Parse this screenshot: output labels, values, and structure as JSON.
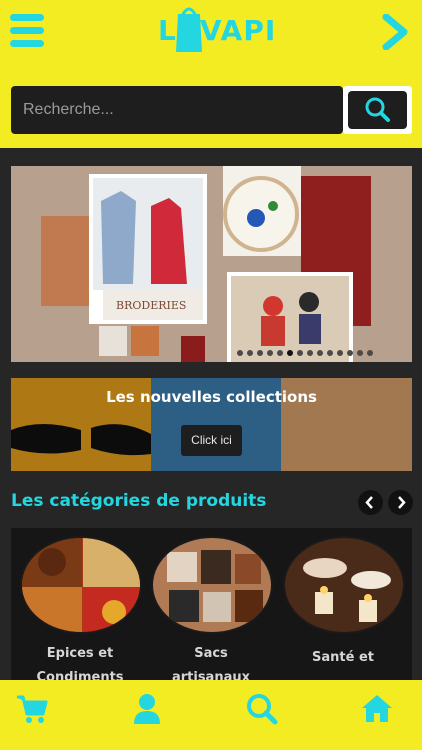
{
  "header": {
    "logo_text": "LOVAPI",
    "menu_icon": "hamburger-menu-icon",
    "next_icon": "chevron-right-icon",
    "accent_color": "#24d6e0",
    "background_color": "#f3ec23"
  },
  "search": {
    "placeholder": "Recherche...",
    "button_icon": "search-icon"
  },
  "banner": {
    "caption": "BRODERIES",
    "slide_count": 14,
    "active_slide": 6
  },
  "collection": {
    "title": "Les nouvelles collections",
    "button_label": "Click ici"
  },
  "categories": {
    "title": "Les catégories de produits",
    "prev_icon": "chevron-left-icon",
    "next_icon": "chevron-right-icon",
    "items": [
      {
        "label": "Epices et",
        "label2": "Condiments"
      },
      {
        "label": "Sacs",
        "label2": "artisanaux"
      },
      {
        "label": "Santé et",
        "label2": ""
      }
    ]
  },
  "bottom_nav": [
    {
      "icon": "cart-icon"
    },
    {
      "icon": "user-icon"
    },
    {
      "icon": "search-icon"
    },
    {
      "icon": "home-icon"
    }
  ]
}
